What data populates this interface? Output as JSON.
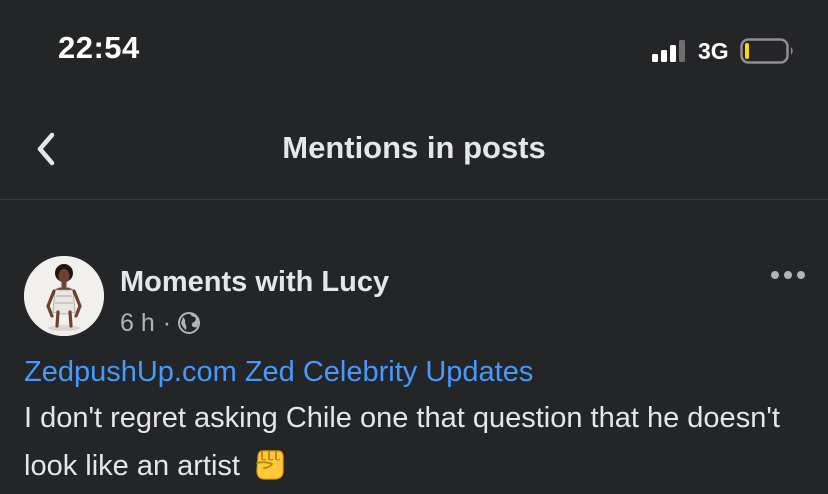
{
  "status_bar": {
    "time": "22:54",
    "network": "3G",
    "signal_icon": "signal-bars-icon",
    "battery_icon": "battery-icon",
    "battery_level": 0.1,
    "battery_color": "#ffd60a"
  },
  "header": {
    "back_icon": "chevron-left-icon",
    "title": "Mentions in posts"
  },
  "post": {
    "author": "Moments with Lucy",
    "time": "6 h",
    "separator": "·",
    "privacy_icon": "globe-icon",
    "more_icon": "more-horizontal-icon",
    "page_link": "ZedpushUp.com Zed Celebrity Updates",
    "text": "I don't regret asking Chile one  that question that he doesn't look like an artist",
    "emoji_icon": "raised-fist-emoji-icon"
  },
  "colors": {
    "background": "#242526",
    "primary_text": "#e4e6eb",
    "secondary_text": "#b0b3b8",
    "link": "#4599ff",
    "divider": "#3a3b3c"
  }
}
